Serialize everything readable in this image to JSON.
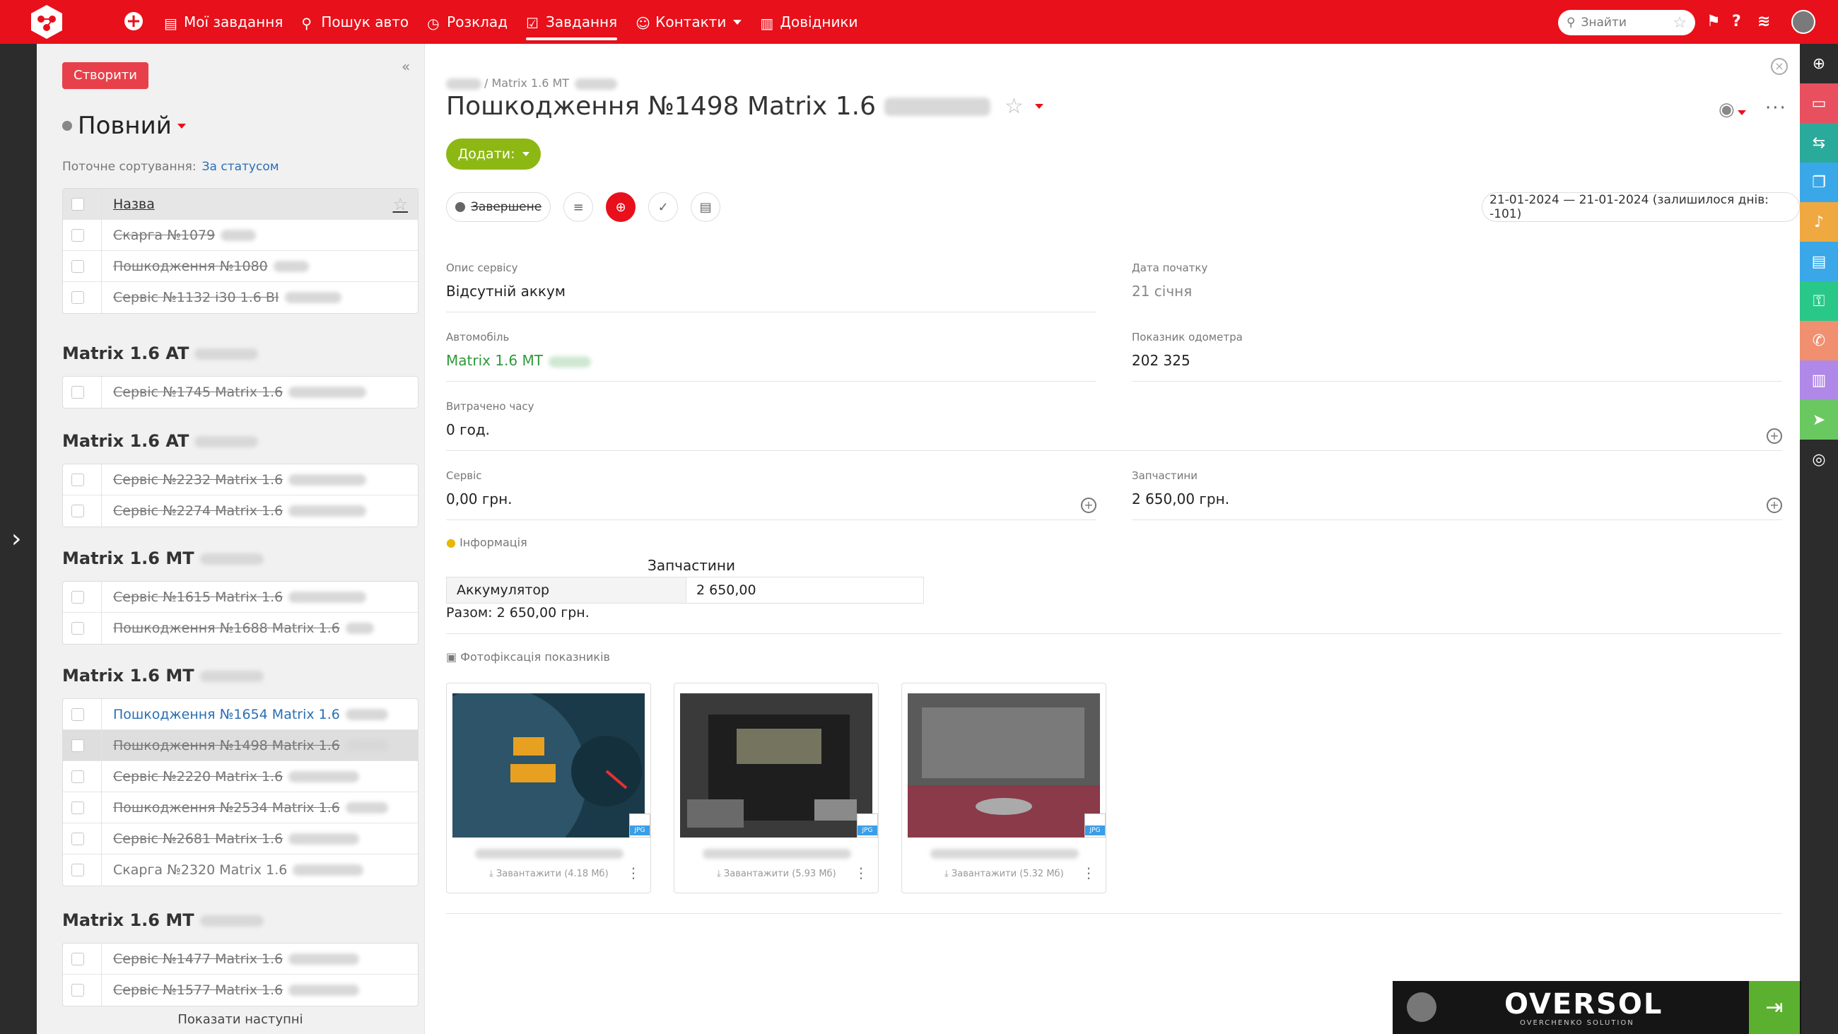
{
  "header": {
    "nav": [
      {
        "label": "Мої завдання",
        "icon": "tasks-icon"
      },
      {
        "label": "Пошук авто",
        "icon": "search-car-icon"
      },
      {
        "label": "Розклад",
        "icon": "calendar-icon"
      },
      {
        "label": "Завдання",
        "icon": "task-check-icon",
        "active": true
      },
      {
        "label": "Контакти",
        "icon": "contacts-icon"
      },
      {
        "label": "Довідники",
        "icon": "book-icon"
      }
    ],
    "search_placeholder": "Знайти"
  },
  "sidebar": {
    "create_label": "Створити",
    "view_title": "Повний",
    "sorting_label": "Поточне сортування:",
    "sorting_value": "За статусом",
    "column_header": "Назва",
    "top_items": [
      "Скарга №1079",
      "Пошкодження №1080",
      "Сервіс №1132 i30 1.6 ВІ"
    ],
    "groups": [
      {
        "title": "Matrix 1.6 AT",
        "items": [
          "Сервіс №1745 Matrix 1.6"
        ]
      },
      {
        "title": "Matrix 1.6 AT",
        "items": [
          "Сервіс №2232 Matrix 1.6",
          "Сервіс №2274 Matrix 1.6"
        ]
      },
      {
        "title": "Matrix 1.6 MT",
        "items": [
          "Сервіс №1615 Matrix 1.6",
          "Пошкодження №1688 Matrix 1.6"
        ]
      },
      {
        "title": "Matrix 1.6 MT",
        "items": [
          "Пошкодження №1654 Matrix 1.6",
          "Пошкодження №1498 Matrix 1.6",
          "Сервіс №2220 Matrix 1.6",
          "Пошкодження №2534 Matrix 1.6",
          "Сервіс №2681 Matrix 1.6",
          "Скарга №2320 Matrix 1.6"
        ]
      },
      {
        "title": "Matrix 1.6 MT",
        "items": [
          "Сервіс №1477 Matrix 1.6",
          "Сервіс №1577 Matrix 1.6"
        ]
      }
    ],
    "show_next": "Показати наступні"
  },
  "detail": {
    "breadcrumb": "/ Matrix 1.6 MT",
    "title": "Пошкодження №1498 Matrix 1.6",
    "add_label": "Додати:",
    "status": "Завершене",
    "date_range": "21-01-2024 — 21-01-2024  (залишилося днів: -101)",
    "fields": {
      "service_desc_label": "Опис сервісу",
      "service_desc": "Відсутній аккум",
      "start_date_label": "Дата початку",
      "start_date": "21 січня",
      "car_label": "Автомобіль",
      "car": "Matrix 1.6 MT",
      "odometer_label": "Показник одометра",
      "odometer": "202 325",
      "time_spent_label": "Витрачено часу",
      "time_spent": "0 год.",
      "service_label": "Сервіс",
      "service": "0,00 грн.",
      "parts_label": "Запчастини",
      "parts": "2 650,00 грн."
    },
    "info_label": "Інформація",
    "parts_table": {
      "title": "Запчастини",
      "item": "Аккумулятор",
      "amount": "2 650,00"
    },
    "total": "Разом: 2 650,00 грн.",
    "photos_label": "Фотофіксація показників",
    "photos": [
      {
        "download": "Завантажити",
        "size": "(4.18 Мб)"
      },
      {
        "download": "Завантажити",
        "size": "(5.93 Мб)"
      },
      {
        "download": "Завантажити",
        "size": "(5.32 Мб)"
      }
    ],
    "file_type": "JPG"
  },
  "brand": {
    "name": "OVERSOL",
    "tagline": "OVERCHENKO SOLUTION"
  },
  "colors": {
    "primary": "#e8101a",
    "add_button": "#8db814",
    "link": "#2a6fb5"
  }
}
